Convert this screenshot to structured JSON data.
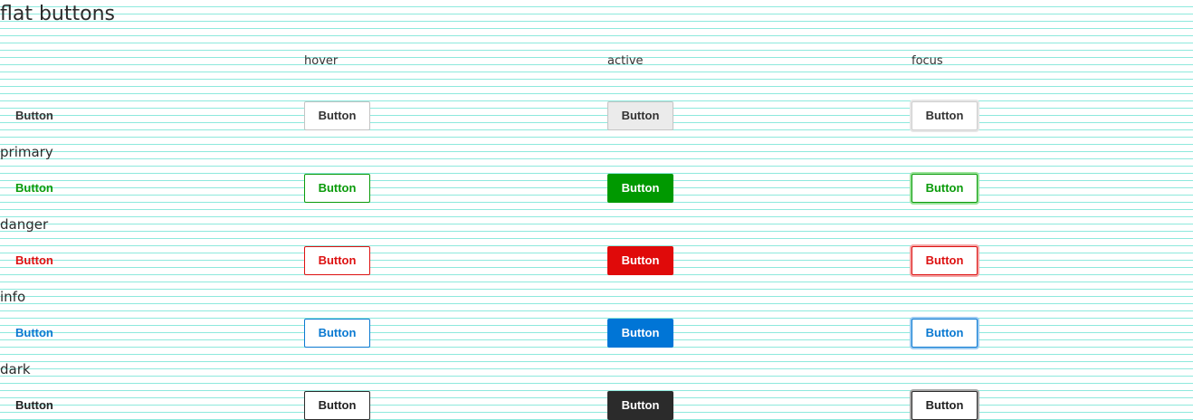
{
  "page": {
    "title": "flat buttons"
  },
  "columns": {
    "hover": "hover",
    "active": "active",
    "focus": "focus"
  },
  "sections": {
    "default": {
      "label": "",
      "button": "Button"
    },
    "primary": {
      "label": "primary",
      "button": "Button"
    },
    "danger": {
      "label": "danger",
      "button": "Button"
    },
    "info": {
      "label": "info",
      "button": "Button"
    },
    "dark": {
      "label": "dark",
      "button": "Button"
    }
  },
  "colors": {
    "background_rule": "#8ee9dd",
    "primary": "#009900",
    "danger": "#e00a0a",
    "info": "#0075d6",
    "dark": "#2b2b2b",
    "default_active": "#ebebeb"
  }
}
